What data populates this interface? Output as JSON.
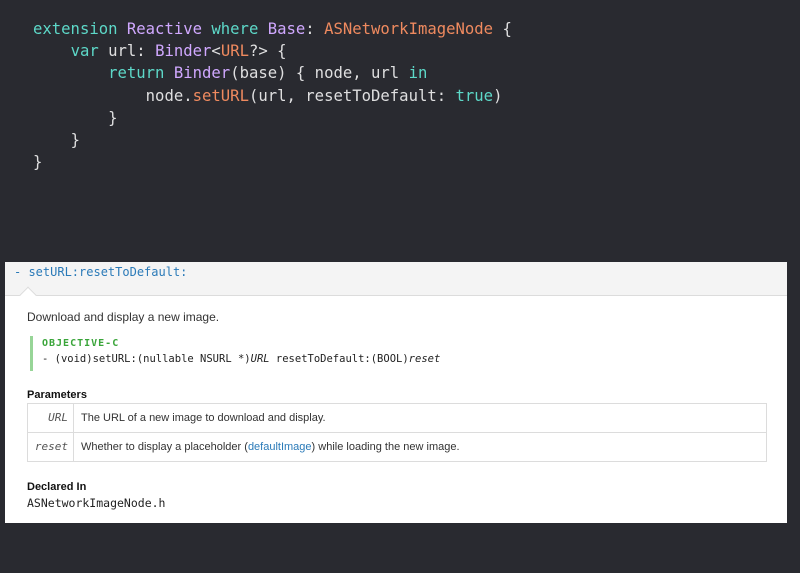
{
  "code": {
    "line1": {
      "kw1": "extension",
      "ty1": "Reactive",
      "kw2": "where",
      "ty2": "Base",
      "colon": ":",
      "ty3": "ASNetworkImageNode",
      "brace": "{"
    },
    "line2": {
      "kw": "var",
      "name": "url:",
      "ty1": "Binder",
      "lt": "<",
      "ty2": "URL",
      "rest": "?> {"
    },
    "line3": {
      "kw": "return",
      "ty": "Binder",
      "args": "(base) { node, url",
      "kw2": "in"
    },
    "line4": {
      "obj": "node.",
      "fn": "setURL",
      "args": "(url, resetToDefault: ",
      "kw": "true",
      "close": ")"
    },
    "line5": "}",
    "line6": "}",
    "line7": "}"
  },
  "doc": {
    "title": "- setURL:resetToDefault:",
    "summary": "Download and display a new image.",
    "declaration": {
      "language": "OBJECTIVE-C",
      "sig_prefix": "- (void)setURL:(nullable NSURL *)",
      "sig_param1": "URL",
      "sig_middle": " resetToDefault:(BOOL)",
      "sig_param2": "reset"
    },
    "parameters_heading": "Parameters",
    "parameters": [
      {
        "name": "URL",
        "desc": "The URL of a new image to download and display."
      },
      {
        "name": "reset",
        "desc_before": "Whether to display a placeholder (",
        "desc_link": "defaultImage",
        "desc_after": ") while loading the new image."
      }
    ],
    "declared_in_heading": "Declared In",
    "declared_in_file": "ASNetworkImageNode.h"
  },
  "colors": {
    "editor_background": "#292a30",
    "keyword": "#5dd8c8",
    "type": "#d0a8ff",
    "function": "#ef8a5f",
    "plain": "#dfdfe0",
    "doc_link": "#2a7ab8",
    "objc_label": "#3aa53a"
  }
}
